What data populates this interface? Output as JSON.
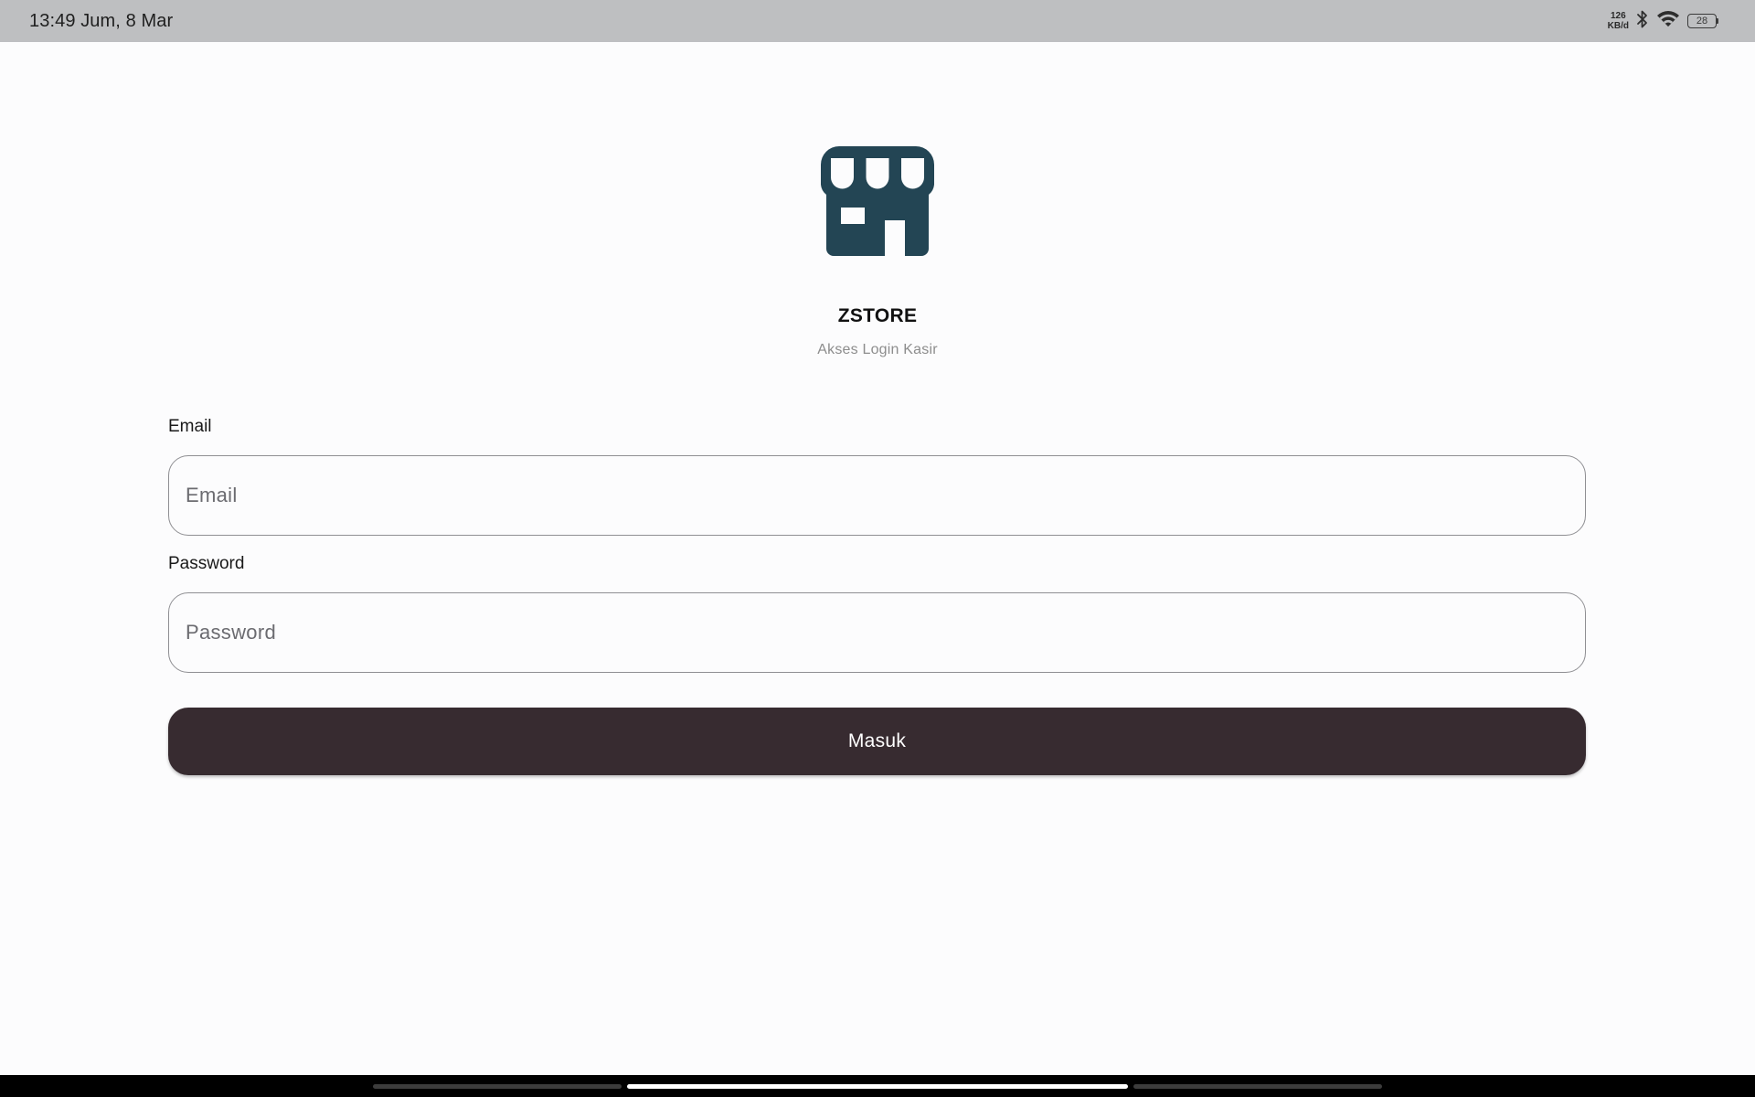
{
  "status_bar": {
    "time": "13:49 Jum, 8 Mar",
    "net_speed_value": "126",
    "net_speed_unit": "KB/d",
    "battery_level": "28",
    "icons": [
      "bluetooth-icon",
      "wifi-icon",
      "battery-icon"
    ]
  },
  "brand": {
    "logo_icon": "store-icon",
    "logo_color": "#234554",
    "name": "ZSTORE",
    "subtitle": "Akses Login Kasir"
  },
  "form": {
    "email": {
      "label": "Email",
      "placeholder": "Email",
      "value": ""
    },
    "password": {
      "label": "Password",
      "placeholder": "Password",
      "value": ""
    },
    "submit_label": "Masuk"
  },
  "colors": {
    "background": "#fcfcfd",
    "button": "#372b30",
    "status_bar": "#bebfc1"
  }
}
